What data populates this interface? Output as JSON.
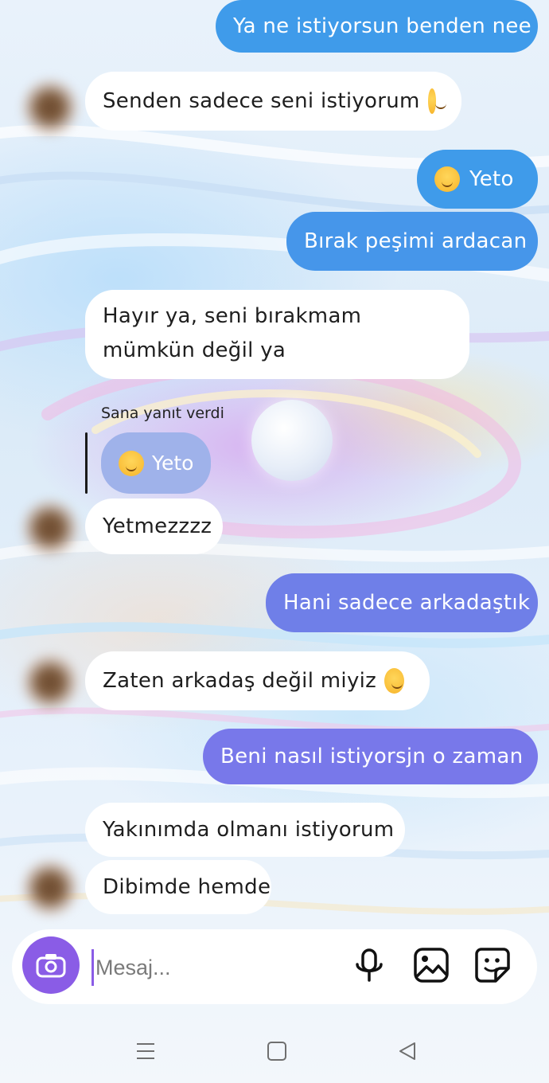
{
  "messages": {
    "m1": "Ya ne istiyorsun benden nee",
    "m2": "Senden sadece seni istiyorum",
    "m3": "Yeto",
    "m4": "Bırak peşimi ardacan",
    "m5": "Hayır ya, seni bırakmam mümkün değil ya",
    "reply_note": "Sana yanıt verdi",
    "reply_quote": "Yeto",
    "m6": "Yetmezzzz",
    "m7": "Hani sadece arkadaştık",
    "m8": "Zaten arkadaş değil miyiz",
    "m9": "Beni nasıl istiyorsjn o zaman",
    "m10": "Yakınımda olmanı istiyorum",
    "m11": "Dibimde hemde"
  },
  "emojis": {
    "m2": "sweat-smile-emoji",
    "m3": "smiling-tear-emoji",
    "reply_quote": "smiling-tear-emoji",
    "m8": "rofl-emoji"
  },
  "composer": {
    "placeholder": "Mesaj...",
    "icons": [
      "camera-icon",
      "microphone-icon",
      "gallery-icon",
      "sticker-icon"
    ]
  },
  "colors": {
    "outgoing_blue": "#3f9bea",
    "outgoing_violet": "#7878ea",
    "incoming": "#ffffff",
    "accent": "#8a5ce6"
  },
  "navbar": {
    "icons": [
      "menu-icon",
      "home-icon",
      "back-icon"
    ]
  }
}
